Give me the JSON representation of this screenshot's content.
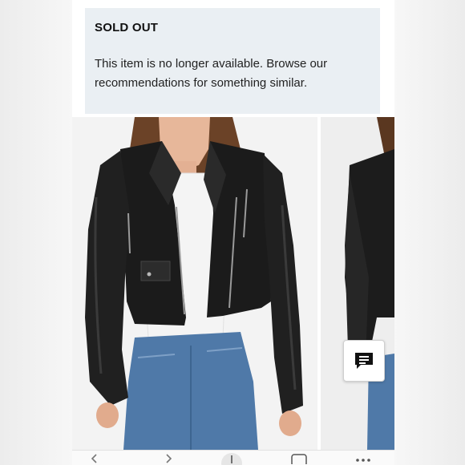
{
  "notice": {
    "title": "SOLD OUT",
    "message": "This item is no longer available. Browse our recommendations for something similar."
  },
  "gallery": {
    "main_image": "model-wearing-cropped-black-leather-moto-jacket",
    "next_image": "model-side-view-black-leather-jacket"
  },
  "chat_button": {
    "icon": "chat-icon"
  },
  "bottom_nav": {
    "items": [
      {
        "icon": "chevron-left-icon"
      },
      {
        "icon": "chevron-right-icon"
      },
      {
        "icon": "upload-icon"
      },
      {
        "icon": "tabs-icon"
      },
      {
        "icon": "more-icon"
      }
    ]
  },
  "colors": {
    "notice_bg": "#eaeff3",
    "jacket": "#1a1a1a",
    "denim": "#4f79a8"
  }
}
